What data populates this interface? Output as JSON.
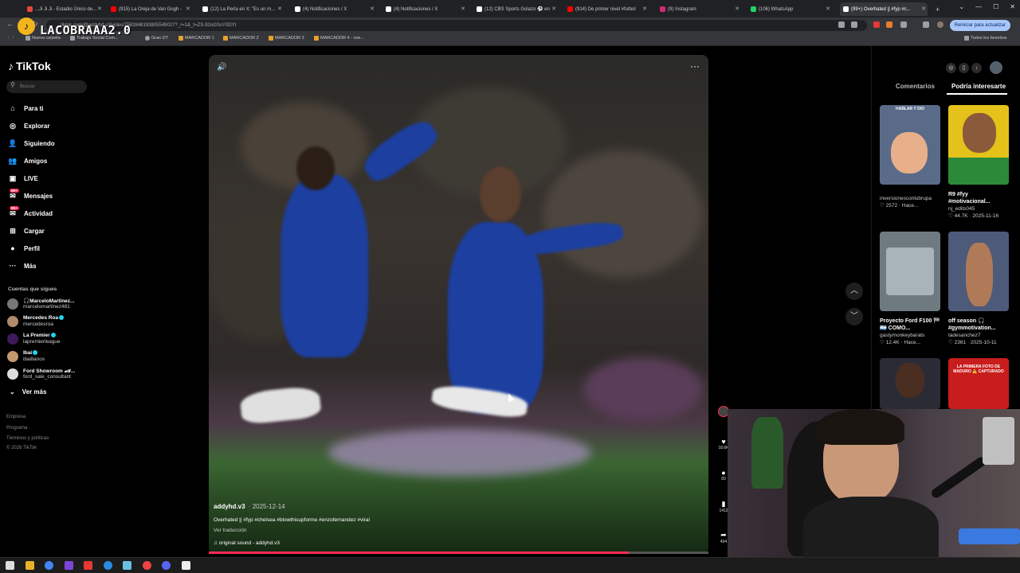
{
  "browser": {
    "tabs": [
      {
        "label": "...Ji Ji Ji - Estadio Único de...",
        "color": "#e8453c"
      },
      {
        "label": "(915) La Oreja de Van Gogh -",
        "color": "#ff0000"
      },
      {
        "label": "(12) La Perla en X: \"Es un m...",
        "color": "#ffffff"
      },
      {
        "label": "(4) Notificaciones / X",
        "color": "#ffffff"
      },
      {
        "label": "(4) Notificaciones / X",
        "color": "#ffffff"
      },
      {
        "label": "(12) CBS Sports Golazo ⚽ en",
        "color": "#ffffff"
      },
      {
        "label": "(914) De primer nivel #futbol",
        "color": "#ff0000"
      },
      {
        "label": "(9) Instagram",
        "color": "#d62976"
      },
      {
        "label": "(106) WhatsApp",
        "color": "#25d366"
      },
      {
        "label": "(99+) Overhated || #fyp #c...",
        "color": "#ffffff"
      }
    ],
    "new_tab": "+",
    "window_controls": [
      "⌄",
      "—",
      "☐",
      "✕"
    ],
    "url": "tiktok.com/@addyhd.v3/video/7583848193805549027?_r=1&_t=ZS-92oGSsY0DYt",
    "update_button": "Reiniciar para actualizar",
    "bookmarks": [
      "Nueva carpeta",
      "Trabajo Social Com...",
      "Gran DT",
      "MARCADOR 1",
      "MARCADOR 2",
      "MARCADOR 3",
      "MARCADOR 4 - ove..."
    ],
    "all_bookmarks": "Todos los favoritos"
  },
  "watermark": {
    "logo": "♪",
    "text": "LACOBRAAA2.0"
  },
  "sidebar": {
    "logo": "TikTok",
    "search_placeholder": "Buscar",
    "nav": [
      {
        "label": "Para ti",
        "icon": "⌂"
      },
      {
        "label": "Explorar",
        "icon": "◎"
      },
      {
        "label": "Siguiendo",
        "icon": "👤"
      },
      {
        "label": "Amigos",
        "icon": "👥"
      },
      {
        "label": "LIVE",
        "icon": "▣"
      },
      {
        "label": "Mensajes",
        "icon": "✉",
        "badge": "99+"
      },
      {
        "label": "Actividad",
        "icon": "✉",
        "badge": "99+"
      },
      {
        "label": "Cargar",
        "icon": "⊞"
      },
      {
        "label": "Perfil",
        "icon": "●"
      },
      {
        "label": "Más",
        "icon": "···"
      }
    ],
    "following_header": "Cuentas que sigues",
    "accounts": [
      {
        "name": "🎧MarceloMartinez...",
        "handle": "marcelomartinez481",
        "color": "#777",
        "verified": false
      },
      {
        "name": "Mercedes Roa",
        "handle": "mercedesroa",
        "color": "#b08a6a",
        "verified": true
      },
      {
        "name": "La Premier",
        "handle": "lapremierleague",
        "color": "#3d195b",
        "verified": true
      },
      {
        "name": "Ibai",
        "handle": "ibaillanos",
        "color": "#c49a6c",
        "verified": true
      },
      {
        "name": "Ford Showroom 🏎...",
        "handle": "ford_sale_consultant",
        "color": "#ddd",
        "verified": false
      }
    ],
    "see_more": "Ver más",
    "footer": [
      "Empresa",
      "Programa",
      "Términos y políticas",
      "© 2026 TikTok"
    ]
  },
  "video": {
    "author": "addyhd.v3",
    "date": "2025-12-14",
    "caption": "Overhated || #fyp #chelsea #blowthisupforme #enzofernandez #viral",
    "translate": "Ver traducción",
    "sound": "original sound - addyhd.v3",
    "progress": 0.84
  },
  "actions": [
    {
      "icon": "♥",
      "count": "18.6K"
    },
    {
      "icon": "●",
      "count": "83"
    },
    {
      "icon": "▮",
      "count": "1413"
    },
    {
      "icon": "➦",
      "count": "404"
    }
  ],
  "right_panel": {
    "tabs": [
      "Comentarios",
      "Podría interesarte"
    ],
    "cards": [
      {
        "title": "",
        "user": "inversionesconlubrupa",
        "meta": "♡ 2572 · Hace...",
        "thumb_caption": "HABLAR Y DIO",
        "bg": "#5a6b8a"
      },
      {
        "title": "R9 #fyy #motivacional...",
        "user": "nj_edits045",
        "meta": "♡ 44.7K · 2025-11-16",
        "thumb_caption": "",
        "bg": "#e4c21a"
      },
      {
        "title": "Proyecto Ford F100 🏁🇦🇷 COMO...",
        "user": "gastymonkeybarats",
        "meta": "♡ 12.4K · Hace...",
        "thumb_caption": "",
        "bg": "#6f7a80"
      },
      {
        "title": "off season 🎧 #gymmotivation...",
        "user": "tadesanchez7",
        "meta": "♡ 2361 · 2025-10-11",
        "thumb_caption": "",
        "bg": "#4d5a7a"
      },
      {
        "title": "",
        "user": "",
        "meta": "",
        "thumb_caption": "",
        "bg": "#2b2b35"
      },
      {
        "title": "",
        "user": "",
        "meta": "",
        "thumb_caption": "LA PRIMERA FOTO DE MADURO ⚠️ CAPTURADO",
        "bg": "#c81d1d"
      }
    ]
  }
}
